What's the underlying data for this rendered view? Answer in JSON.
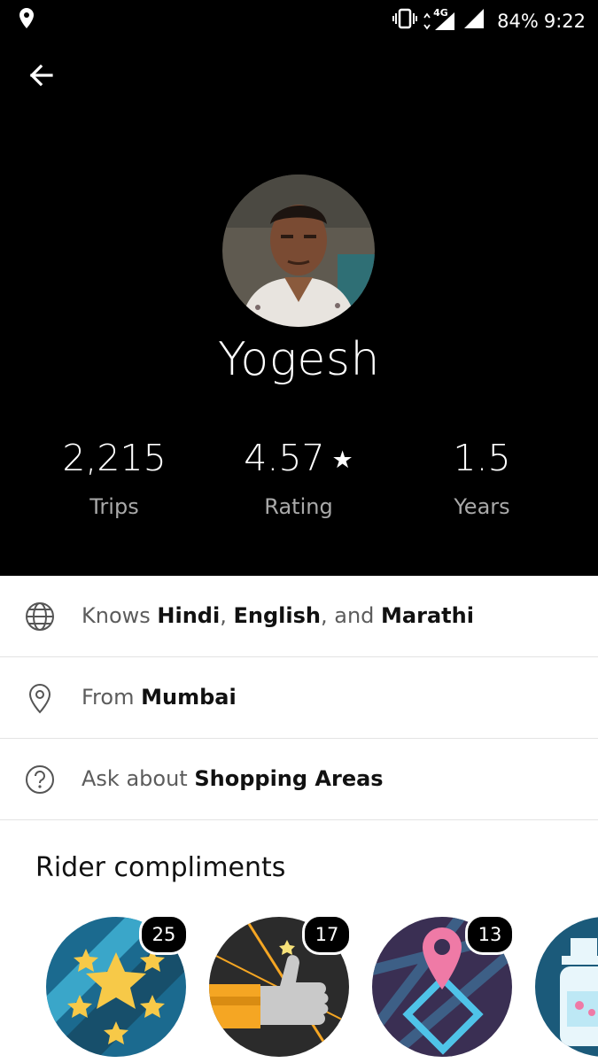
{
  "status_bar": {
    "battery": "84%",
    "time": "9:22",
    "network": "4G"
  },
  "driver": {
    "name": "Yogesh",
    "stats": [
      {
        "value": "2,215",
        "label": "Trips"
      },
      {
        "value": "4.57",
        "label": "Rating",
        "icon": "star-icon"
      },
      {
        "value": "1.5",
        "label": "Years"
      }
    ]
  },
  "info": {
    "languages": {
      "prefix": "Knows",
      "lang1": "Hindi",
      "sep1": ",",
      "lang2": "English",
      "sep2": ", and",
      "lang3": "Marathi"
    },
    "from": {
      "prefix": "From",
      "place": "Mumbai"
    },
    "ask": {
      "prefix": "Ask about",
      "topic": "Shopping Areas"
    }
  },
  "compliments": {
    "title": "Rider compliments",
    "items": [
      {
        "icon": "stars-icon",
        "count": "25",
        "bg": "#1b6a8f"
      },
      {
        "icon": "thumbs-up-icon",
        "count": "17",
        "bg": "#2b2b2b"
      },
      {
        "icon": "map-pin-route-icon",
        "count": "13",
        "bg": "#3a2f53"
      },
      {
        "icon": "cleaning-spray-icon",
        "bg": "#1b5a7a"
      }
    ]
  }
}
